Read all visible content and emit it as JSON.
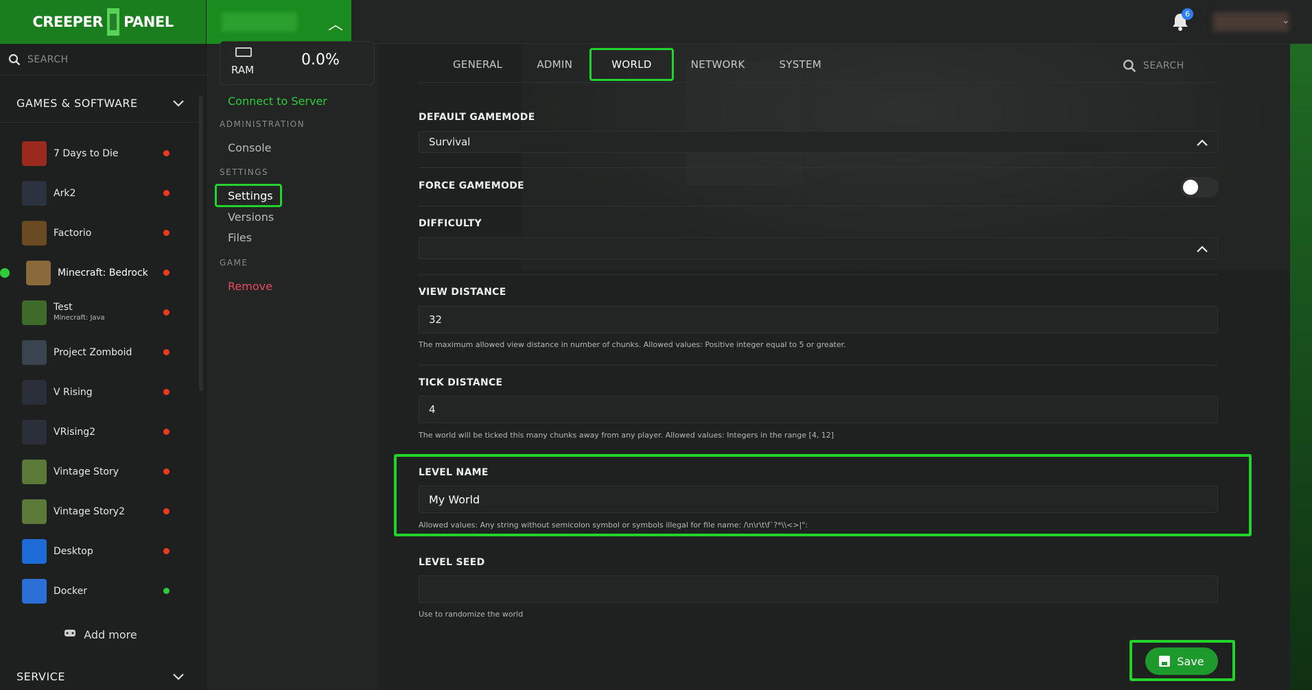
{
  "header": {
    "logo_text": "CREEPERPANEL",
    "notifications_count": "6"
  },
  "sidebar": {
    "search_placeholder": "SEARCH",
    "games_section": "GAMES & SOFTWARE",
    "service_section": "SERVICE",
    "add_more": "Add more",
    "games": [
      {
        "name": "7 Days to Die",
        "sub": "",
        "status": "offline",
        "color": "#9b2a1e"
      },
      {
        "name": "Ark2",
        "sub": "",
        "status": "offline",
        "color": "#2b3340"
      },
      {
        "name": "Factorio",
        "sub": "",
        "status": "offline",
        "color": "#6a4a22"
      },
      {
        "name": "Minecraft: Bedrock",
        "sub": "",
        "status": "offline",
        "color": "#8a6a3a"
      },
      {
        "name": "Test",
        "sub": "Minecraft: Java",
        "status": "offline",
        "color": "#3f6b2a"
      },
      {
        "name": "Project Zomboid",
        "sub": "",
        "status": "offline",
        "color": "#3a4450"
      },
      {
        "name": "V Rising",
        "sub": "",
        "status": "offline",
        "color": "#2a2f3a"
      },
      {
        "name": "VRising2",
        "sub": "",
        "status": "offline",
        "color": "#2a2f3a"
      },
      {
        "name": "Vintage Story",
        "sub": "",
        "status": "offline",
        "color": "#5b7a3a"
      },
      {
        "name": "Vintage Story2",
        "sub": "",
        "status": "offline",
        "color": "#5b7a3a"
      },
      {
        "name": "Desktop",
        "sub": "",
        "status": "offline",
        "color": "#1e6ad6"
      },
      {
        "name": "Docker",
        "sub": "",
        "status": "online",
        "color": "#2b6fd6"
      }
    ],
    "status_colors": {
      "offline": "#f2391d",
      "online": "#2ecb3b"
    }
  },
  "subnav": {
    "ram_label": "RAM",
    "ram_value": "0.0%",
    "connect": "Connect to Server",
    "administration": "ADMINISTRATION",
    "console": "Console",
    "settings_cat": "SETTINGS",
    "settings": "Settings",
    "versions": "Versions",
    "files": "Files",
    "game_cat": "GAME",
    "remove": "Remove"
  },
  "tabs": [
    "GENERAL",
    "ADMIN",
    "WORLD",
    "NETWORK",
    "SYSTEM"
  ],
  "active_tab": "WORLD",
  "tab_search": "SEARCH",
  "form": {
    "default_gamemode": {
      "label": "DEFAULT GAMEMODE",
      "value": "Survival"
    },
    "force_gamemode": {
      "label": "FORCE GAMEMODE",
      "enabled": false
    },
    "difficulty": {
      "label": "DIFFICULTY",
      "value": ""
    },
    "view_distance": {
      "label": "VIEW DISTANCE",
      "value": "32",
      "help": "The maximum allowed view distance in number of chunks. Allowed values: Positive integer equal to 5 or greater."
    },
    "tick_distance": {
      "label": "TICK DISTANCE",
      "value": "4",
      "help": "The world will be ticked this many chunks away from any player. Allowed values: Integers in the range [4, 12]"
    },
    "level_name": {
      "label": "LEVEL NAME",
      "value": "My World",
      "help": "Allowed values: Any string without semicolon symbol or symbols illegal for file name: /\\n\\r\\t\\f`?*\\\\<>|\":"
    },
    "level_seed": {
      "label": "LEVEL SEED",
      "value": "",
      "help": "Use to randomize the world"
    }
  },
  "save_label": "Save"
}
